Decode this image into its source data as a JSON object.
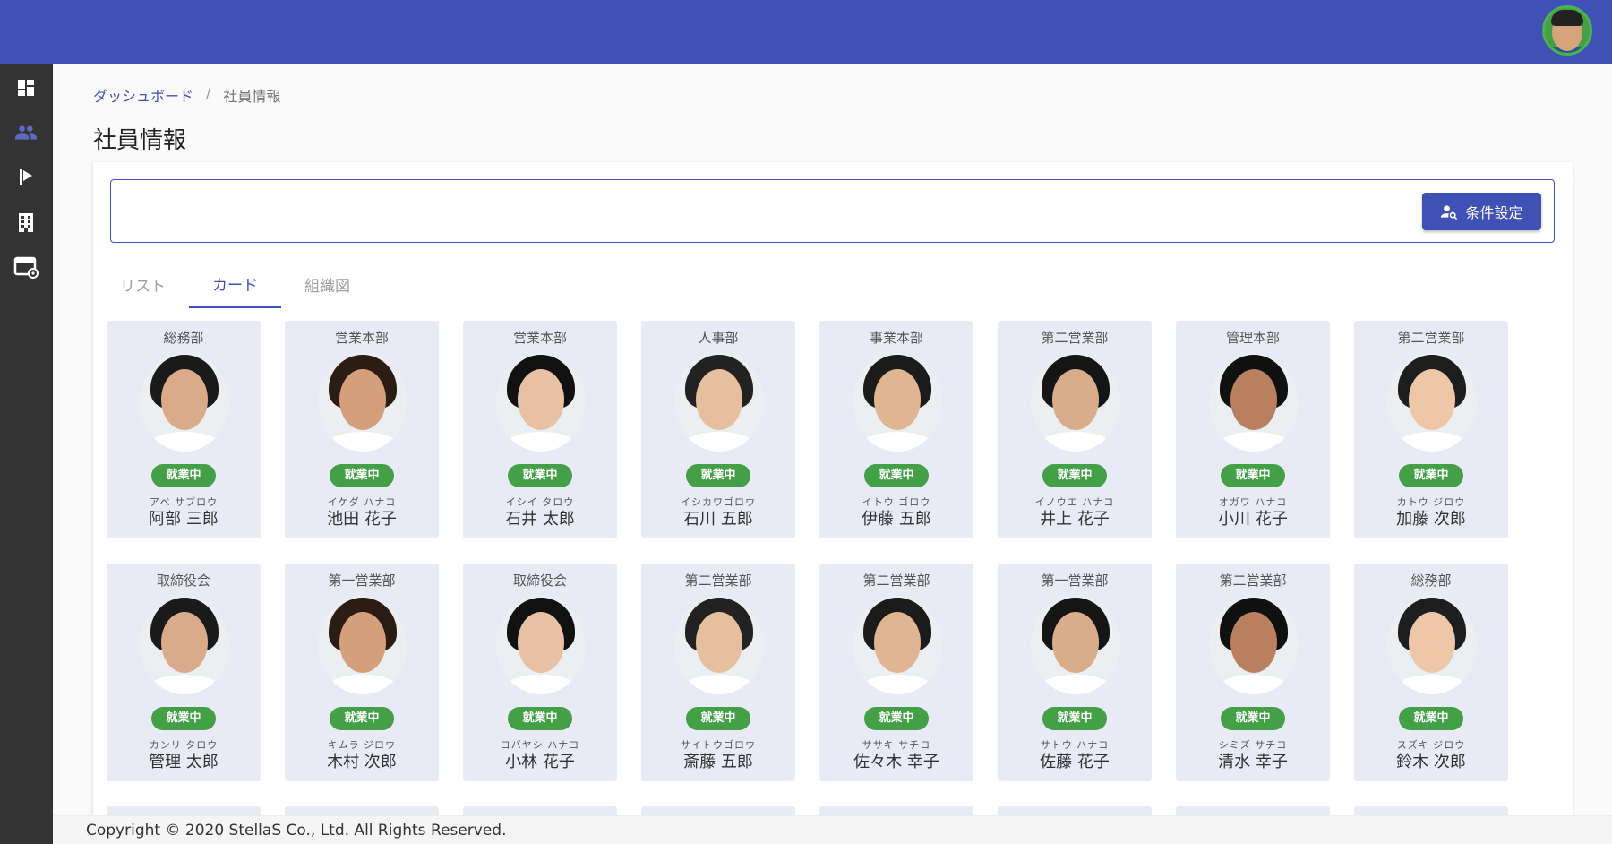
{
  "breadcrumb": {
    "home": "ダッシュボード",
    "separator": "/",
    "current": "社員情報"
  },
  "page": {
    "title": "社員情報"
  },
  "search": {
    "placeholder": "",
    "button_label": "条件設定",
    "button_icon": "person-search-icon"
  },
  "tabs": [
    {
      "label": "リスト",
      "active": false
    },
    {
      "label": "カード",
      "active": true
    },
    {
      "label": "組織図",
      "active": false
    }
  ],
  "sidebar": {
    "items": [
      {
        "icon": "dashboard-icon"
      },
      {
        "icon": "people-icon",
        "active": true
      },
      {
        "icon": "flag-icon"
      },
      {
        "icon": "building-icon"
      },
      {
        "icon": "settings-window-icon"
      }
    ]
  },
  "employees": [
    {
      "dept": "総務部",
      "status": "就業中",
      "kana": "アベ サブロウ",
      "name": "阿部 三郎"
    },
    {
      "dept": "営業本部",
      "status": "就業中",
      "kana": "イケダ ハナコ",
      "name": "池田 花子"
    },
    {
      "dept": "営業本部",
      "status": "就業中",
      "kana": "イシイ タロウ",
      "name": "石井 太郎"
    },
    {
      "dept": "人事部",
      "status": "就業中",
      "kana": "イシカワゴロウ",
      "name": "石川 五郎"
    },
    {
      "dept": "事業本部",
      "status": "就業中",
      "kana": "イトウ ゴロウ",
      "name": "伊藤 五郎"
    },
    {
      "dept": "第二営業部",
      "status": "就業中",
      "kana": "イノウエ ハナコ",
      "name": "井上 花子"
    },
    {
      "dept": "管理本部",
      "status": "就業中",
      "kana": "オガワ ハナコ",
      "name": "小川 花子"
    },
    {
      "dept": "第二営業部",
      "status": "就業中",
      "kana": "カトウ ジロウ",
      "name": "加藤 次郎"
    },
    {
      "dept": "取締役会",
      "status": "就業中",
      "kana": "カンリ タロウ",
      "name": "管理 太郎"
    },
    {
      "dept": "第一営業部",
      "status": "就業中",
      "kana": "キムラ ジロウ",
      "name": "木村 次郎"
    },
    {
      "dept": "取締役会",
      "status": "就業中",
      "kana": "コバヤシ ハナコ",
      "name": "小林 花子"
    },
    {
      "dept": "第二営業部",
      "status": "就業中",
      "kana": "サイトウゴロウ",
      "name": "斎藤 五郎"
    },
    {
      "dept": "第二営業部",
      "status": "就業中",
      "kana": "ササキ サチコ",
      "name": "佐々木 幸子"
    },
    {
      "dept": "第一営業部",
      "status": "就業中",
      "kana": "サトウ ハナコ",
      "name": "佐藤 花子"
    },
    {
      "dept": "第二営業部",
      "status": "就業中",
      "kana": "シミズ サチコ",
      "name": "清水 幸子"
    },
    {
      "dept": "総務部",
      "status": "就業中",
      "kana": "スズキ ジロウ",
      "name": "鈴木 次郎"
    }
  ],
  "footer": {
    "copyright": "Copyright © 2020 StellaS Co., Ltd. All Rights Reserved."
  },
  "colors": {
    "primary": "#3f51b5",
    "sidebar": "#333333",
    "status": "#43a047",
    "card_bg": "#e8eaf6"
  }
}
